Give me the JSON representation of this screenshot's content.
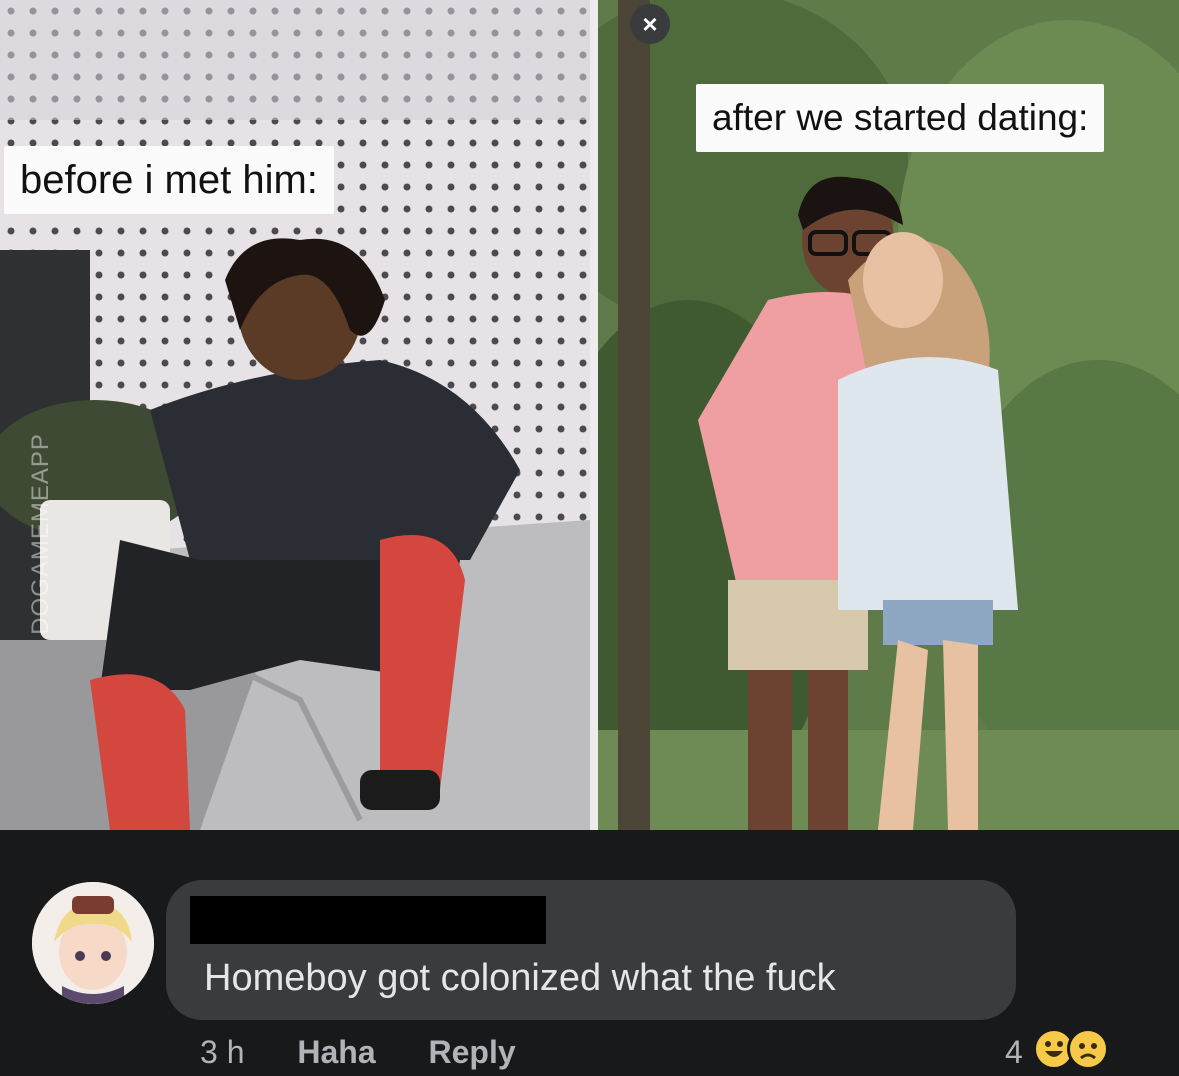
{
  "meme": {
    "caption_left": "before i met him:",
    "caption_right": "after we started dating:",
    "watermark": "DOGAMEMEAPP",
    "close_symbol": "×"
  },
  "comment": {
    "text": "Homeboy got colonized what the fuck",
    "time": "3 h",
    "haha_label": "Haha",
    "reply_label": "Reply",
    "reaction_count": "4",
    "reaction_icons": [
      "haha-emoji",
      "sad-emoji"
    ]
  },
  "colors": {
    "comment_bubble": "#3a3b3c",
    "background": "#18191a",
    "reaction_yellow": "#f7c948"
  }
}
